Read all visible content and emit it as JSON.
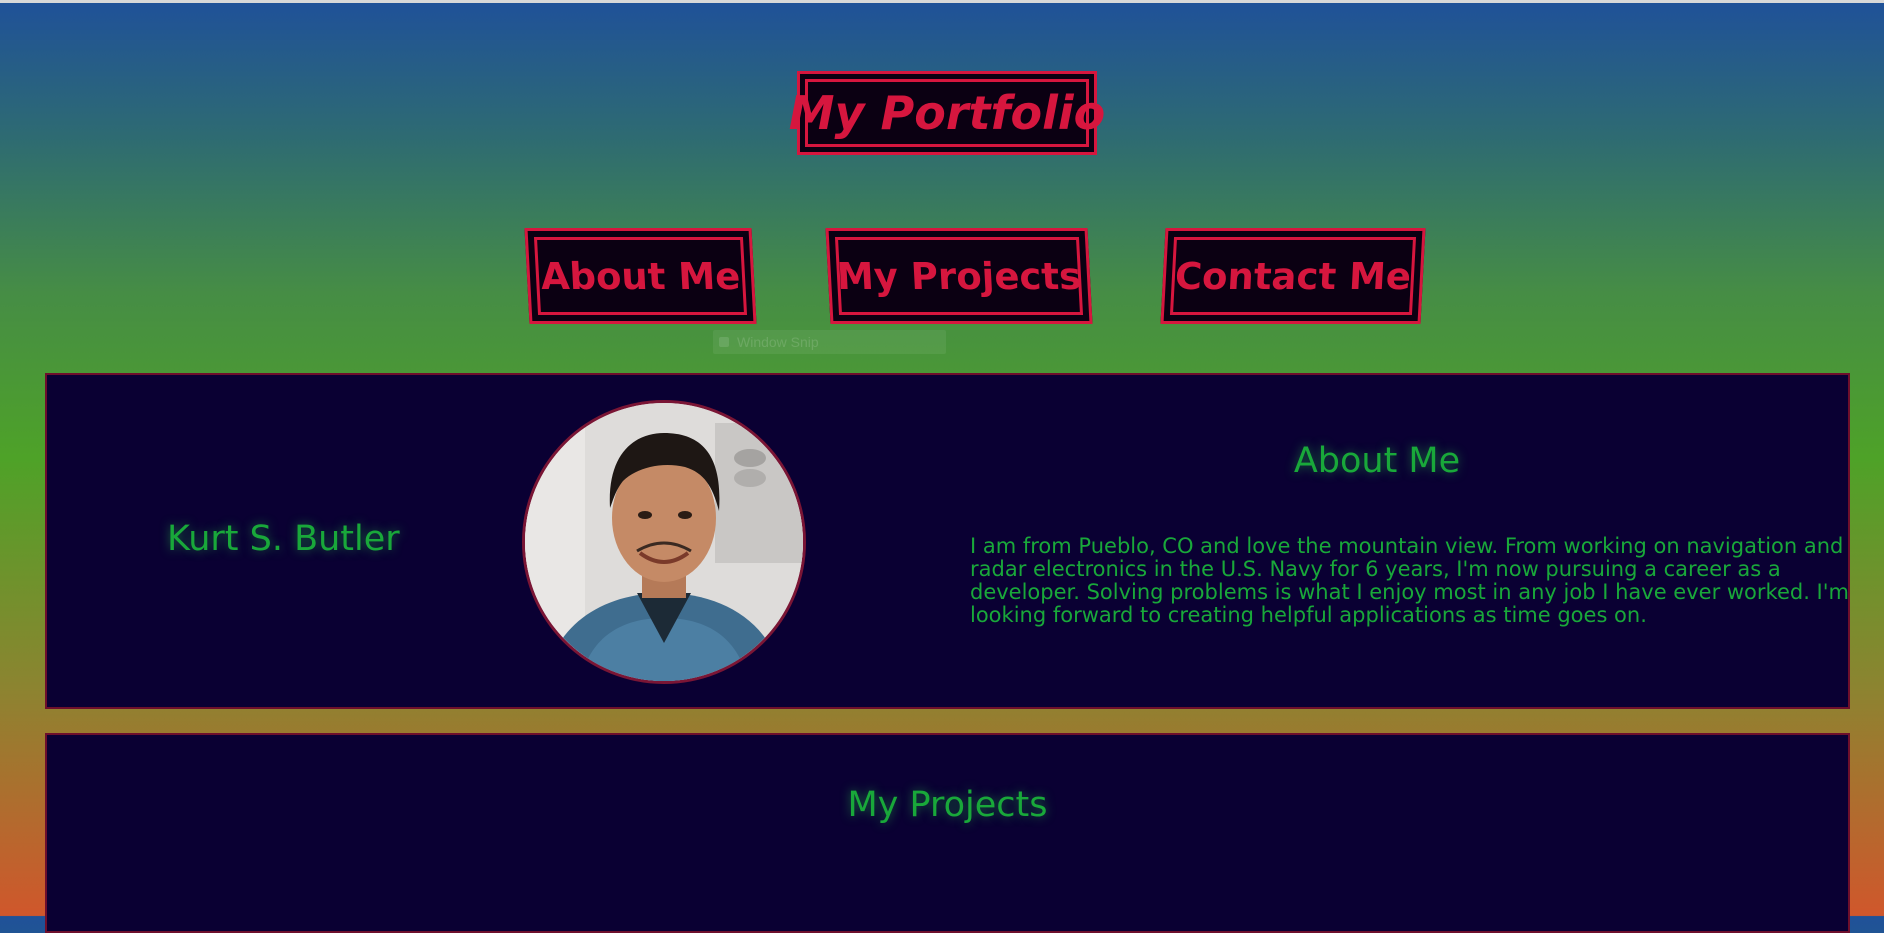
{
  "header": {
    "title": "My Portfolio"
  },
  "nav": {
    "items": [
      {
        "label": "About Me"
      },
      {
        "label": "My Projects"
      },
      {
        "label": "Contact Me"
      }
    ]
  },
  "overlay": {
    "ghost_label": "Window Snip"
  },
  "about": {
    "name": "Kurt S. Butler",
    "heading": "About Me",
    "paragraph": "I am from Pueblo, CO and love the mountain view. From working on navigation and radar electronics in the U.S. Navy for 6 years, I'm now pursuing a career as a developer. Solving problems is what I enjoy most in any job I have ever worked. I'm looking forward to creating helpful applications as time goes on.",
    "photo_icon": "profile-photo"
  },
  "projects": {
    "heading": "My Projects"
  },
  "colors": {
    "accent_red": "#d6163e",
    "text_green": "#19a83a",
    "panel_navy": "#0a0033",
    "box_black": "#0b0012"
  }
}
